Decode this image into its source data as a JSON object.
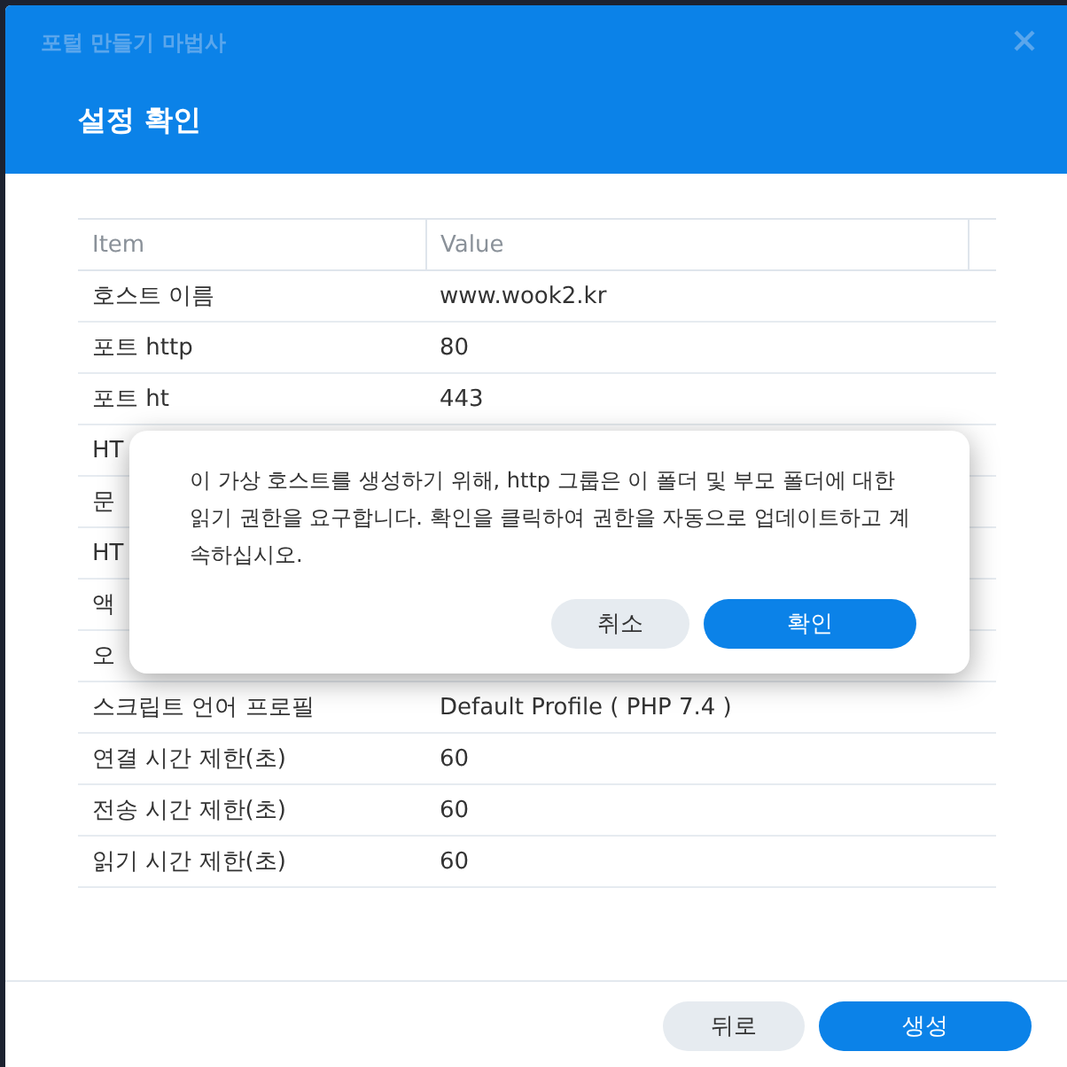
{
  "window": {
    "title": "포털 만들기 마법사"
  },
  "step_title": "설정 확인",
  "table": {
    "columns": [
      "Item",
      "Value"
    ],
    "rows": [
      {
        "item": "호스트 이름",
        "value": "www.wook2.kr"
      },
      {
        "item": "포트 http",
        "value": "80"
      },
      {
        "item": "포트 ht",
        "value": "443"
      },
      {
        "item": "HT"
      },
      {
        "item": "문"
      },
      {
        "item": "HT"
      },
      {
        "item": "액"
      },
      {
        "item": "오"
      },
      {
        "item": "스크립트 언어 프로필",
        "value": "Default Profile ( PHP 7.4 )"
      },
      {
        "item": "연결 시간 제한(초)",
        "value": "60"
      },
      {
        "item": "전송 시간 제한(초)",
        "value": "60"
      },
      {
        "item": "읽기 시간 제한(초)",
        "value": "60"
      }
    ]
  },
  "dialog": {
    "message": "이 가상 호스트를 생성하기 위해, http 그룹은 이 폴더 및 부모 폴더에 대한 읽기 권한을 요구합니다. 확인을 클릭하여 권한을 자동으로 업데이트하고 계속하십시오.",
    "buttons": [
      {
        "label": "취소",
        "kind": "secondary"
      },
      {
        "label": "확인",
        "kind": "primary"
      }
    ]
  },
  "footer": {
    "buttons": [
      {
        "label": "뒤로",
        "kind": "secondary"
      },
      {
        "label": "생성",
        "kind": "primary"
      }
    ]
  }
}
